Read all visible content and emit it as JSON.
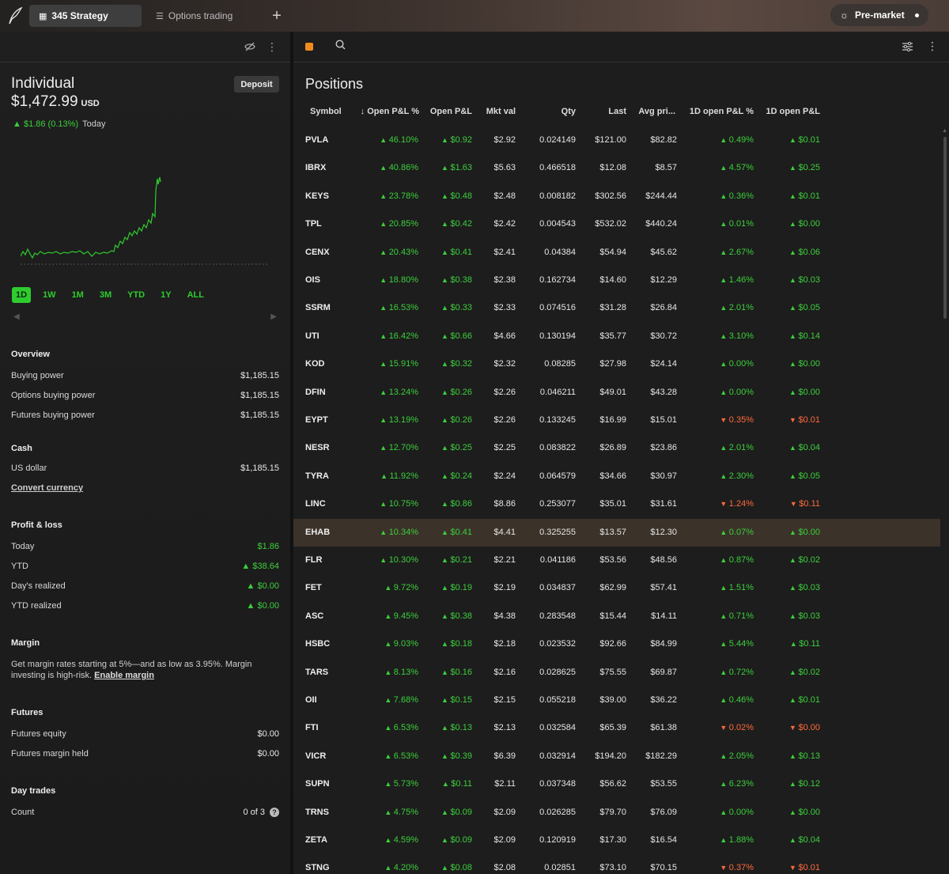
{
  "topbar": {
    "tabs": [
      {
        "label": "345 Strategy",
        "icon": "grid-icon"
      },
      {
        "label": "Options trading",
        "icon": "list-icon"
      }
    ],
    "market_status": "Pre-market"
  },
  "account": {
    "name": "Individual",
    "value": "$1,472.99",
    "currency": "USD",
    "deposit_label": "Deposit",
    "today_change": "$1.86 (0.13%)",
    "today_label": "Today"
  },
  "ranges": [
    "1D",
    "1W",
    "1M",
    "3M",
    "YTD",
    "1Y",
    "ALL"
  ],
  "overview": {
    "title": "Overview",
    "rows": [
      {
        "label": "Buying power",
        "value": "$1,185.15"
      },
      {
        "label": "Options buying power",
        "value": "$1,185.15"
      },
      {
        "label": "Futures buying power",
        "value": "$1,185.15"
      }
    ]
  },
  "cash": {
    "title": "Cash",
    "rows": [
      {
        "label": "US dollar",
        "value": "$1,185.15"
      }
    ],
    "link": "Convert currency"
  },
  "pnl": {
    "title": "Profit & loss",
    "rows": [
      {
        "label": "Today",
        "value": "$1.86",
        "arrow": false
      },
      {
        "label": "YTD",
        "value": "$38.64",
        "arrow": true
      },
      {
        "label": "Day's realized",
        "value": "$0.00",
        "arrow": true
      },
      {
        "label": "YTD realized",
        "value": "$0.00",
        "arrow": true
      }
    ]
  },
  "margin": {
    "title": "Margin",
    "text": "Get margin rates starting at 5%—and as low as 3.95%. Margin investing is high-risk.",
    "link": "Enable margin"
  },
  "futures": {
    "title": "Futures",
    "rows": [
      {
        "label": "Futures equity",
        "value": "$0.00"
      },
      {
        "label": "Futures margin held",
        "value": "$0.00"
      }
    ]
  },
  "daytrades": {
    "title": "Day trades",
    "label": "Count",
    "value": "0 of 3"
  },
  "positions": {
    "title": "Positions",
    "columns": [
      "Symbol",
      "Open P&L %",
      "Open P&L",
      "Mkt val",
      "Qty",
      "Last",
      "Avg pri...",
      "1D open P&L %",
      "1D open P&L"
    ],
    "rows": [
      {
        "sym": "PVLA",
        "pct": "46.10%",
        "pl": "$0.92",
        "mkt": "$2.92",
        "qty": "0.024149",
        "last": "$121.00",
        "avg": "$82.82",
        "d1pct": "0.49%",
        "d1pl": "$0.01",
        "d1up": true
      },
      {
        "sym": "IBRX",
        "pct": "40.86%",
        "pl": "$1.63",
        "mkt": "$5.63",
        "qty": "0.466518",
        "last": "$12.08",
        "avg": "$8.57",
        "d1pct": "4.57%",
        "d1pl": "$0.25",
        "d1up": true
      },
      {
        "sym": "KEYS",
        "pct": "23.78%",
        "pl": "$0.48",
        "mkt": "$2.48",
        "qty": "0.008182",
        "last": "$302.56",
        "avg": "$244.44",
        "d1pct": "0.36%",
        "d1pl": "$0.01",
        "d1up": true
      },
      {
        "sym": "TPL",
        "pct": "20.85%",
        "pl": "$0.42",
        "mkt": "$2.42",
        "qty": "0.004543",
        "last": "$532.02",
        "avg": "$440.24",
        "d1pct": "0.01%",
        "d1pl": "$0.00",
        "d1up": true
      },
      {
        "sym": "CENX",
        "pct": "20.43%",
        "pl": "$0.41",
        "mkt": "$2.41",
        "qty": "0.04384",
        "last": "$54.94",
        "avg": "$45.62",
        "d1pct": "2.67%",
        "d1pl": "$0.06",
        "d1up": true
      },
      {
        "sym": "OIS",
        "pct": "18.80%",
        "pl": "$0.38",
        "mkt": "$2.38",
        "qty": "0.162734",
        "last": "$14.60",
        "avg": "$12.29",
        "d1pct": "1.46%",
        "d1pl": "$0.03",
        "d1up": true
      },
      {
        "sym": "SSRM",
        "pct": "16.53%",
        "pl": "$0.33",
        "mkt": "$2.33",
        "qty": "0.074516",
        "last": "$31.28",
        "avg": "$26.84",
        "d1pct": "2.01%",
        "d1pl": "$0.05",
        "d1up": true
      },
      {
        "sym": "UTI",
        "pct": "16.42%",
        "pl": "$0.66",
        "mkt": "$4.66",
        "qty": "0.130194",
        "last": "$35.77",
        "avg": "$30.72",
        "d1pct": "3.10%",
        "d1pl": "$0.14",
        "d1up": true
      },
      {
        "sym": "KOD",
        "pct": "15.91%",
        "pl": "$0.32",
        "mkt": "$2.32",
        "qty": "0.08285",
        "last": "$27.98",
        "avg": "$24.14",
        "d1pct": "0.00%",
        "d1pl": "$0.00",
        "d1up": true
      },
      {
        "sym": "DFIN",
        "pct": "13.24%",
        "pl": "$0.26",
        "mkt": "$2.26",
        "qty": "0.046211",
        "last": "$49.01",
        "avg": "$43.28",
        "d1pct": "0.00%",
        "d1pl": "$0.00",
        "d1up": true
      },
      {
        "sym": "EYPT",
        "pct": "13.19%",
        "pl": "$0.26",
        "mkt": "$2.26",
        "qty": "0.133245",
        "last": "$16.99",
        "avg": "$15.01",
        "d1pct": "0.35%",
        "d1pl": "$0.01",
        "d1up": false
      },
      {
        "sym": "NESR",
        "pct": "12.70%",
        "pl": "$0.25",
        "mkt": "$2.25",
        "qty": "0.083822",
        "last": "$26.89",
        "avg": "$23.86",
        "d1pct": "2.01%",
        "d1pl": "$0.04",
        "d1up": true
      },
      {
        "sym": "TYRA",
        "pct": "11.92%",
        "pl": "$0.24",
        "mkt": "$2.24",
        "qty": "0.064579",
        "last": "$34.66",
        "avg": "$30.97",
        "d1pct": "2.30%",
        "d1pl": "$0.05",
        "d1up": true
      },
      {
        "sym": "LINC",
        "pct": "10.75%",
        "pl": "$0.86",
        "mkt": "$8.86",
        "qty": "0.253077",
        "last": "$35.01",
        "avg": "$31.61",
        "d1pct": "1.24%",
        "d1pl": "$0.11",
        "d1up": false
      },
      {
        "sym": "EHAB",
        "pct": "10.34%",
        "pl": "$0.41",
        "mkt": "$4.41",
        "qty": "0.325255",
        "last": "$13.57",
        "avg": "$12.30",
        "d1pct": "0.07%",
        "d1pl": "$0.00",
        "d1up": true,
        "highlight": true
      },
      {
        "sym": "FLR",
        "pct": "10.30%",
        "pl": "$0.21",
        "mkt": "$2.21",
        "qty": "0.041186",
        "last": "$53.56",
        "avg": "$48.56",
        "d1pct": "0.87%",
        "d1pl": "$0.02",
        "d1up": true
      },
      {
        "sym": "FET",
        "pct": "9.72%",
        "pl": "$0.19",
        "mkt": "$2.19",
        "qty": "0.034837",
        "last": "$62.99",
        "avg": "$57.41",
        "d1pct": "1.51%",
        "d1pl": "$0.03",
        "d1up": true
      },
      {
        "sym": "ASC",
        "pct": "9.45%",
        "pl": "$0.38",
        "mkt": "$4.38",
        "qty": "0.283548",
        "last": "$15.44",
        "avg": "$14.11",
        "d1pct": "0.71%",
        "d1pl": "$0.03",
        "d1up": true
      },
      {
        "sym": "HSBC",
        "pct": "9.03%",
        "pl": "$0.18",
        "mkt": "$2.18",
        "qty": "0.023532",
        "last": "$92.66",
        "avg": "$84.99",
        "d1pct": "5.44%",
        "d1pl": "$0.11",
        "d1up": true
      },
      {
        "sym": "TARS",
        "pct": "8.13%",
        "pl": "$0.16",
        "mkt": "$2.16",
        "qty": "0.028625",
        "last": "$75.55",
        "avg": "$69.87",
        "d1pct": "0.72%",
        "d1pl": "$0.02",
        "d1up": true
      },
      {
        "sym": "OII",
        "pct": "7.68%",
        "pl": "$0.15",
        "mkt": "$2.15",
        "qty": "0.055218",
        "last": "$39.00",
        "avg": "$36.22",
        "d1pct": "0.46%",
        "d1pl": "$0.01",
        "d1up": true
      },
      {
        "sym": "FTI",
        "pct": "6.53%",
        "pl": "$0.13",
        "mkt": "$2.13",
        "qty": "0.032584",
        "last": "$65.39",
        "avg": "$61.38",
        "d1pct": "0.02%",
        "d1pl": "$0.00",
        "d1up": false
      },
      {
        "sym": "VICR",
        "pct": "6.53%",
        "pl": "$0.39",
        "mkt": "$6.39",
        "qty": "0.032914",
        "last": "$194.20",
        "avg": "$182.29",
        "d1pct": "2.05%",
        "d1pl": "$0.13",
        "d1up": true
      },
      {
        "sym": "SUPN",
        "pct": "5.73%",
        "pl": "$0.11",
        "mkt": "$2.11",
        "qty": "0.037348",
        "last": "$56.62",
        "avg": "$53.55",
        "d1pct": "6.23%",
        "d1pl": "$0.12",
        "d1up": true
      },
      {
        "sym": "TRNS",
        "pct": "4.75%",
        "pl": "$0.09",
        "mkt": "$2.09",
        "qty": "0.026285",
        "last": "$79.70",
        "avg": "$76.09",
        "d1pct": "0.00%",
        "d1pl": "$0.00",
        "d1up": true
      },
      {
        "sym": "ZETA",
        "pct": "4.59%",
        "pl": "$0.09",
        "mkt": "$2.09",
        "qty": "0.120919",
        "last": "$17.30",
        "avg": "$16.54",
        "d1pct": "1.88%",
        "d1pl": "$0.04",
        "d1up": true
      },
      {
        "sym": "STNG",
        "pct": "4.20%",
        "pl": "$0.08",
        "mkt": "$2.08",
        "qty": "0.02851",
        "last": "$73.10",
        "avg": "$70.15",
        "d1pct": "0.37%",
        "d1pl": "$0.01",
        "d1up": false
      }
    ]
  },
  "colors": {
    "up": "#3ccf3c",
    "down": "#ff6a3d",
    "accent": "#f08c1c"
  }
}
